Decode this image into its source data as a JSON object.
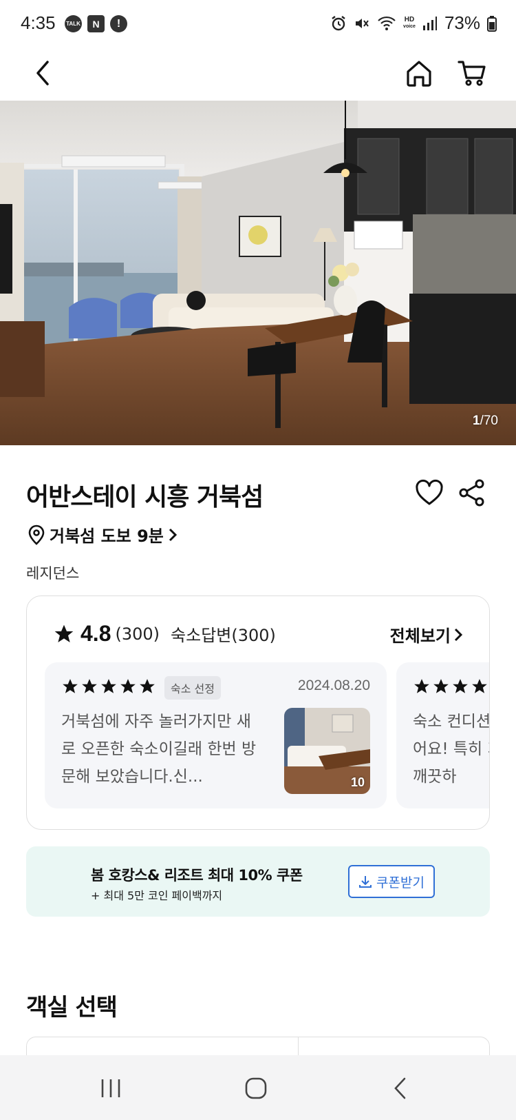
{
  "status_bar": {
    "time": "4:35",
    "left_icons": [
      "kakaotalk-icon",
      "naver-icon",
      "alert-icon"
    ],
    "talk_label": "TALK",
    "naver_label": "N",
    "alert_label": "!",
    "hd_label": "HD",
    "volte_label": "voice",
    "battery": "73%"
  },
  "nav": {
    "back_icon": "chevron-left-icon",
    "home_icon": "home-icon",
    "cart_icon": "cart-icon"
  },
  "hero": {
    "counter_current": "1",
    "counter_total": "/70"
  },
  "property": {
    "title": "어반스테이 시흥 거북섬",
    "location": "거북섬 도보 9분",
    "category": "레지던스"
  },
  "reviews": {
    "rating": "4.8",
    "count": "(300)",
    "host_reply": "숙소답변(300)",
    "see_all": "전체보기",
    "items": [
      {
        "badge": "숙소 선정",
        "date": "2024.08.20",
        "text": "거북섬에 자주 놀러가지만 새로 오픈한 숙소이길래 한번 방문해 보았습니다.신...",
        "photo_count": "10"
      },
      {
        "text": "숙소 컨디션 좋았어요! 특히 가구류 깨끗하"
      }
    ]
  },
  "coupon": {
    "title": "봄 호캉스& 리조트 최대 10% 쿠폰",
    "subtitle": "+ 최대 5만 코인 페이백까지",
    "button": "쿠폰받기"
  },
  "rooms": {
    "section_title": "객실 선택"
  },
  "colors": {
    "accent_blue": "#2f6fd6",
    "coupon_bg": "#eaf7f4",
    "review_bg": "#f5f6f9"
  }
}
